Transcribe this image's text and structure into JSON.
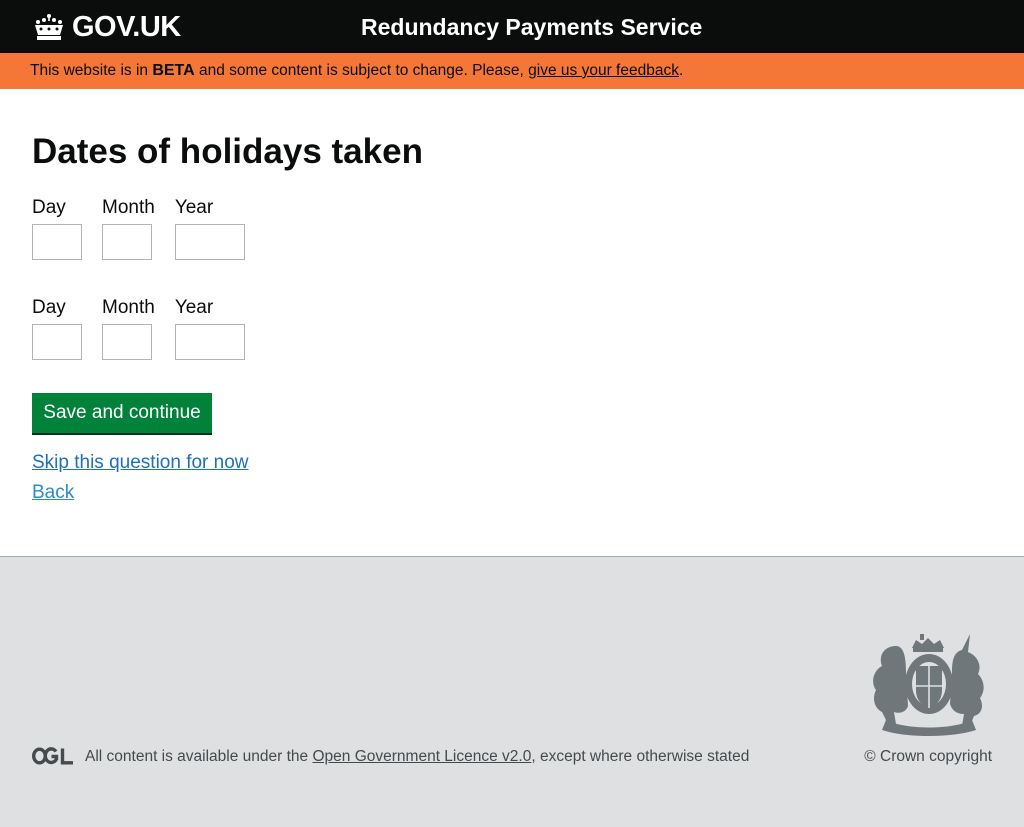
{
  "header": {
    "logo_text": "GOV.UK",
    "service_name": "Redundancy Payments Service"
  },
  "beta_banner": {
    "prefix": "This website is in ",
    "tag": "BETA",
    "middle": " and some content is subject to change. Please, ",
    "feedback_link": "give us your feedback",
    "suffix": "."
  },
  "main": {
    "title": "Dates of holidays taken",
    "date_groups": [
      {
        "day_label": "Day",
        "month_label": "Month",
        "year_label": "Year",
        "day_value": "",
        "month_value": "",
        "year_value": ""
      },
      {
        "day_label": "Day",
        "month_label": "Month",
        "year_label": "Year",
        "day_value": "",
        "month_value": "",
        "year_value": ""
      }
    ],
    "submit_label": "Save and continue",
    "skip_link": "Skip this question for now",
    "back_link": "Back"
  },
  "footer": {
    "ogl_icon": "ogl-logo-icon",
    "licence_prefix": "All content is available under the ",
    "licence_link": "Open Government Licence v2.0",
    "licence_suffix": ", except where otherwise stated",
    "crest_icon": "royal-coat-of-arms-icon",
    "copyright": "© Crown copyright"
  },
  "colors": {
    "header_bg": "#0b0c0c",
    "beta_bg": "#f47738",
    "button_bg": "#00823b",
    "link": "#1d70b8",
    "footer_bg": "#dee0e2"
  }
}
